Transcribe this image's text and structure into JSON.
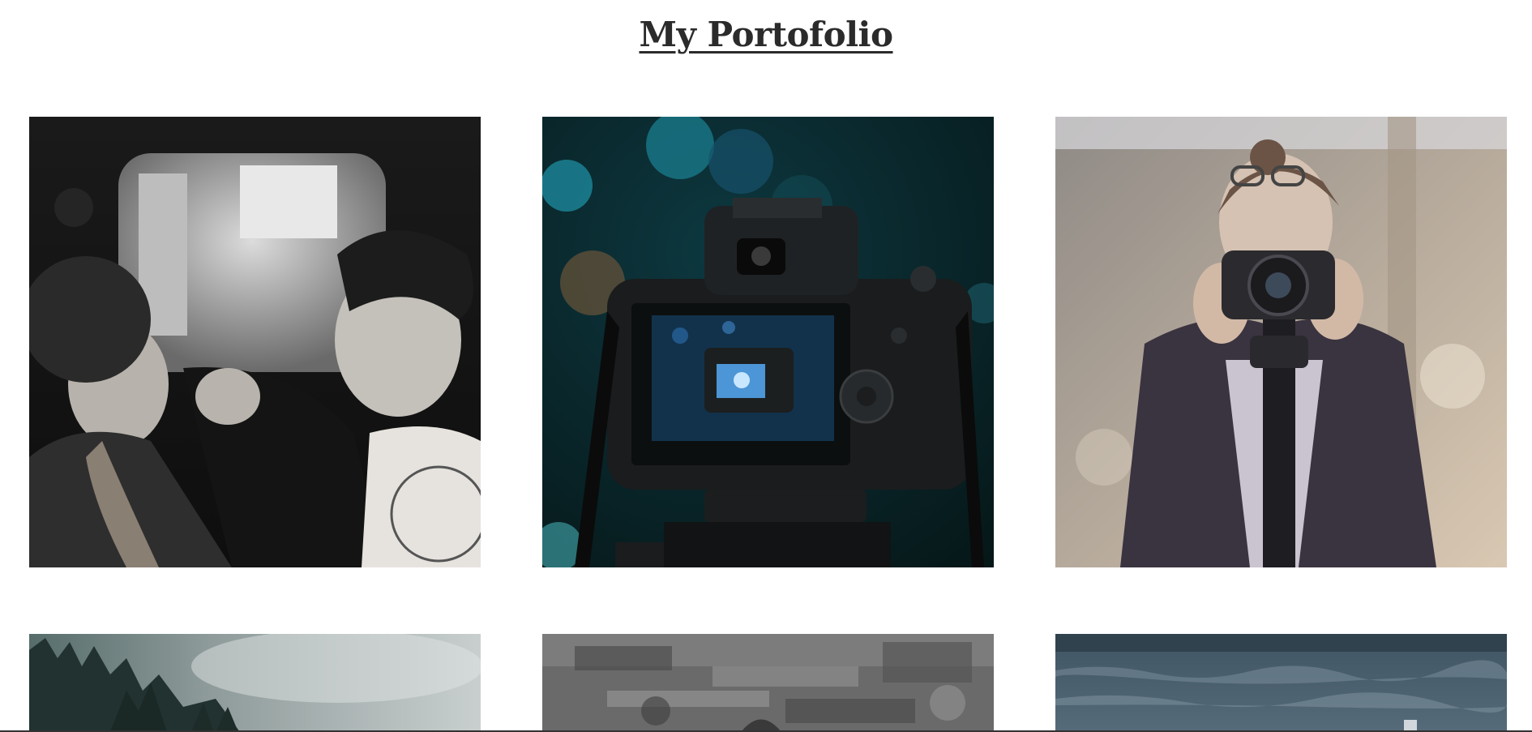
{
  "header": {
    "title": "My Portofolio"
  },
  "gallery": {
    "items": [
      {
        "subject": "two-people-bw-photo"
      },
      {
        "subject": "camera-on-tripod-photo"
      },
      {
        "subject": "woman-with-camera-photo"
      },
      {
        "subject": "misty-forest-photo"
      },
      {
        "subject": "grunge-texture-photo"
      },
      {
        "subject": "ocean-waves-photo"
      }
    ]
  },
  "colors": {
    "title": "#2b2b2b",
    "background": "#ffffff"
  }
}
